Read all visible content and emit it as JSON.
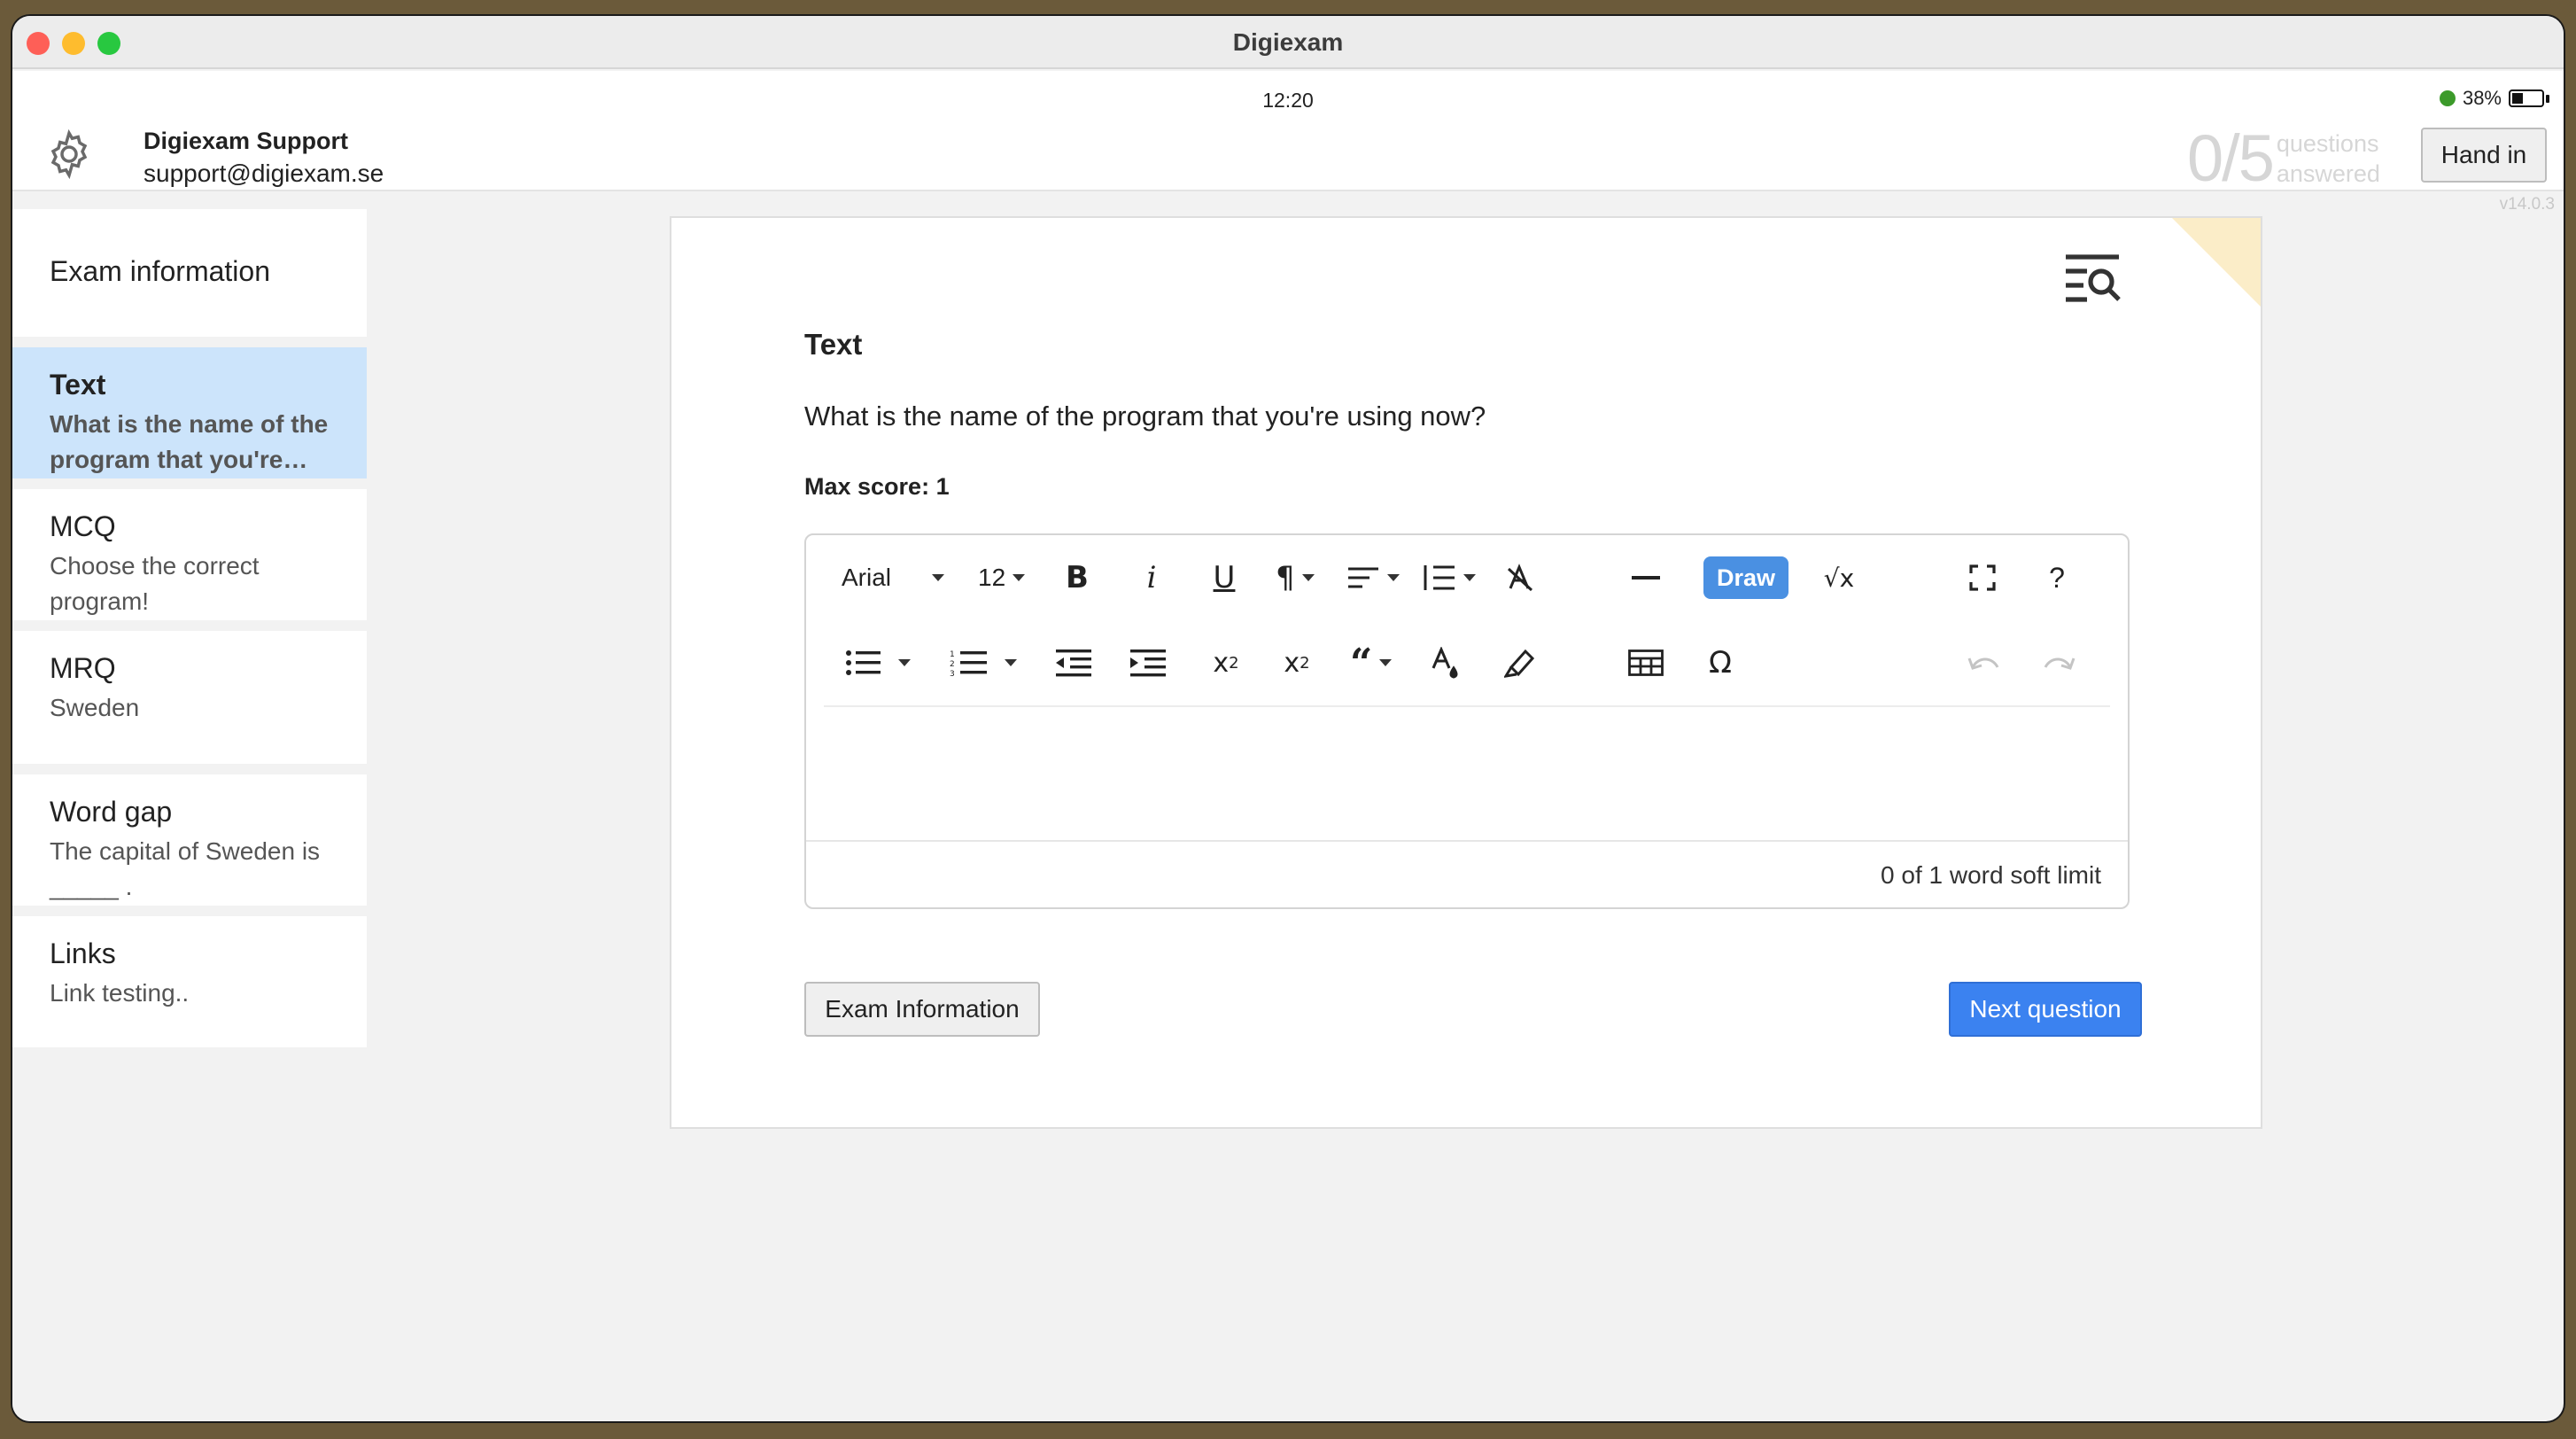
{
  "window": {
    "title": "Digiexam"
  },
  "status": {
    "time": "12:20",
    "battery_percent": "38%",
    "battery_level": 0.38
  },
  "user": {
    "name": "Digiexam Support",
    "email": "support@digiexam.se"
  },
  "progress": {
    "count": "0/5",
    "label_line1": "questions",
    "label_line2": "answered"
  },
  "header": {
    "hand_in_label": "Hand in",
    "version": "v14.0.3"
  },
  "sidebar": {
    "items": [
      {
        "title": "Exam information",
        "subtitle": ""
      },
      {
        "title": "Text",
        "subtitle": "What is the name of the program that you're…",
        "active": true
      },
      {
        "title": "MCQ",
        "subtitle": "Choose the correct program!"
      },
      {
        "title": "MRQ",
        "subtitle": "Sweden"
      },
      {
        "title": "Word gap",
        "subtitle": "The capital of Sweden is _____ ."
      },
      {
        "title": "Links",
        "subtitle": "Link testing.."
      }
    ]
  },
  "question": {
    "type": "Text",
    "text": "What is the name of the program that you're using now?",
    "max_score": "Max score: 1"
  },
  "editor": {
    "font_family": "Arial",
    "font_size": "12",
    "draw_label": "Draw",
    "word_limit": "0 of 1 word soft limit",
    "icons": [
      "bold-icon",
      "italic-icon",
      "underline-icon",
      "paragraph-icon",
      "align-icon",
      "line-height-icon",
      "clear-format-icon",
      "horizontal-rule-icon",
      "math-icon",
      "fullscreen-icon",
      "help-icon",
      "bullet-list-icon",
      "numbered-list-icon",
      "outdent-icon",
      "indent-icon",
      "subscript-icon",
      "superscript-icon",
      "quote-icon",
      "font-color-icon",
      "highlight-icon",
      "table-icon",
      "special-char-icon",
      "undo-icon",
      "redo-icon"
    ]
  },
  "buttons": {
    "exam_info_label": "Exam Information",
    "next_label": "Next question"
  },
  "colors": {
    "accent": "#3b82f0",
    "active_item": "#cce4fb",
    "corner_flag": "#fbedc8"
  }
}
